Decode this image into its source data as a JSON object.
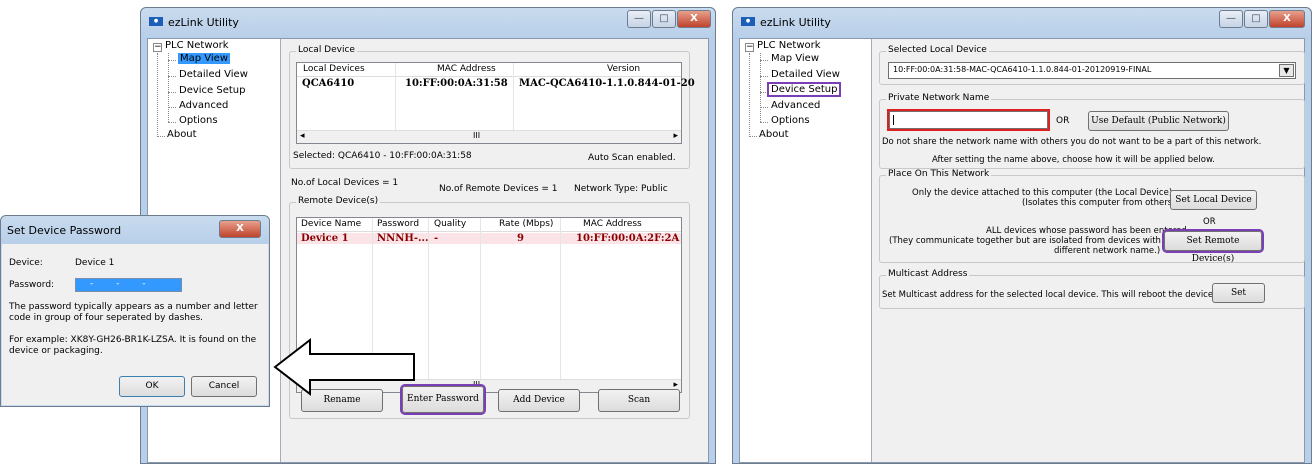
{
  "left_window": {
    "title": "ezLink Utility",
    "controls": {
      "minimize": "—",
      "maximize": "□",
      "close": "X"
    },
    "tree": {
      "root": "PLC Network",
      "items": [
        "Map View",
        "Detailed View",
        "Device Setup",
        "Advanced",
        "Options"
      ],
      "about": "About",
      "selected": "Map View"
    },
    "local_device": {
      "group_label": "Local Device",
      "columns": [
        "Local Devices",
        "MAC Address",
        "Version"
      ],
      "rows": [
        {
          "device": "QCA6410",
          "mac": "10:FF:00:0A:31:58",
          "version": "MAC-QCA6410-1.1.0.844-01-20"
        }
      ],
      "selected_text": "Selected: QCA6410 - 10:FF:00:0A:31:58",
      "auto_scan": "Auto Scan enabled.",
      "scroll_mark": "III"
    },
    "stats": {
      "local_count": "No.of Local Devices = 1",
      "remote_count": "No.of Remote Devices = 1",
      "network_type": "Network Type: Public"
    },
    "remote_devices": {
      "group_label": "Remote Device(s)",
      "columns": [
        "Device Name",
        "Password",
        "Quality",
        "Rate (Mbps)",
        "MAC Address"
      ],
      "rows": [
        {
          "name": "Device 1",
          "password": "NNNH-...",
          "quality": "-",
          "rate": "9",
          "mac": "10:FF:00:0A:2F:2A"
        }
      ],
      "scroll_mark": "III"
    },
    "buttons": {
      "rename": "Rename",
      "enter_password": "Enter Password",
      "add_device": "Add Device",
      "scan": "Scan"
    }
  },
  "dialog": {
    "title": "Set Device Password",
    "close": "X",
    "device_label": "Device:",
    "device_value": "Device 1",
    "password_label": "Password:",
    "password_value": "- - -",
    "help1": "The password typically appears as a number and letter code in group of four seperated by dashes.",
    "help2": "For example: XK8Y-GH26-BR1K-LZSA. It is found on the device or packaging.",
    "ok": "OK",
    "cancel": "Cancel"
  },
  "right_window": {
    "title": "ezLink Utility",
    "tree": {
      "root": "PLC Network",
      "items": [
        "Map View",
        "Detailed View",
        "Device Setup",
        "Advanced",
        "Options"
      ],
      "about": "About",
      "selected": "Device Setup"
    },
    "selected_local_device": {
      "group_label": "Selected Local Device",
      "value": "10:FF:00:0A:31:58-MAC-QCA6410-1.1.0.844-01-20120919-FINAL"
    },
    "private_network": {
      "group_label": "Private Network Name",
      "input_value": "",
      "or": "OR",
      "use_default": "Use Default (Public Network)",
      "warning": "Do not share the network name with others you do not want to be a part of this network.",
      "after": "After setting the name above, choose how it will be applied below."
    },
    "place_on_network": {
      "group_label": "Place On This Network",
      "local_text1": "Only the device attached to this computer (the Local Device).",
      "local_text2": "(Isolates this computer from others):",
      "set_local": "Set Local Device",
      "or": "OR",
      "remote_text1": "ALL devices whose password has been entered.",
      "remote_text2": "(They communicate together but are isolated from devices with a",
      "remote_text3": "different network name.)",
      "set_remote": "Set Remote Device(s)"
    },
    "multicast": {
      "group_label": "Multicast Address",
      "text": "Set Multicast address for the selected local device. This will reboot the device.",
      "set": "Set"
    }
  },
  "colors": {
    "highlight_purple": "#7a3fb5",
    "highlight_red": "#e02020",
    "selection_blue": "#3399ff",
    "remote_row_text": "#8b0000"
  }
}
